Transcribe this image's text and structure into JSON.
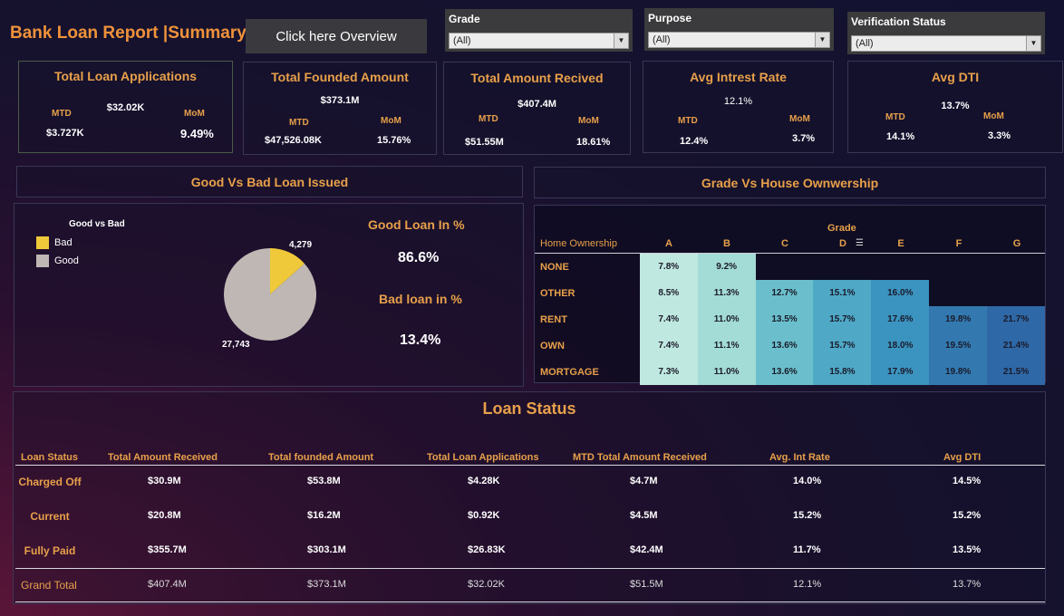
{
  "header": {
    "title": "Bank Loan Report |Summary",
    "overview_button": "Click here Overview"
  },
  "filters": [
    {
      "label": "Grade",
      "value": "(All)"
    },
    {
      "label": "Purpose",
      "value": "(All)"
    },
    {
      "label": "Verification Status",
      "value": "(All)"
    }
  ],
  "kpis": [
    {
      "title": "Total Loan Applications",
      "main": "$32.02K",
      "mtd_label": "MTD",
      "mtd": "$3.727K",
      "mom_label": "MoM",
      "mom": "9.49%"
    },
    {
      "title": "Total Founded Amount",
      "main": "$373.1M",
      "mtd_label": "MTD",
      "mtd": "$47,526.08K",
      "mom_label": "MoM",
      "mom": "15.76%"
    },
    {
      "title": "Total Amount Recived",
      "main": "$407.4M",
      "mtd_label": "MTD",
      "mtd": "$51.55M",
      "mom_label": "MoM",
      "mom": "18.61%"
    },
    {
      "title": "Avg Intrest Rate",
      "main": "12.1%",
      "mtd_label": "MTD",
      "mtd": "12.4%",
      "mom_label": "MoM",
      "mom": "3.7%"
    },
    {
      "title": "Avg DTI",
      "main": "13.7%",
      "mtd_label": "MTD",
      "mtd": "14.1%",
      "mom_label": "MoM",
      "mom": "3.3%"
    }
  ],
  "good_bad": {
    "section_title": "Good Vs Bad Loan Issued",
    "legend_title": "Good vs Bad",
    "legend": [
      {
        "label": "Bad",
        "color": "#f0c93a"
      },
      {
        "label": "Good",
        "color": "#bfb7b3"
      }
    ],
    "good_pct_label": "Good Loan In %",
    "good_pct": "86.6%",
    "bad_pct_label": "Bad loan in %",
    "bad_pct": "13.4%"
  },
  "chart_data": {
    "type": "pie",
    "title": "Good vs Bad",
    "slices": [
      {
        "label": "Bad",
        "value": 4279,
        "display": "4,279",
        "color": "#f0c93a"
      },
      {
        "label": "Good",
        "value": 27743,
        "display": "27,743",
        "color": "#bfb7b3"
      }
    ]
  },
  "heatmap": {
    "section_title": "Grade Vs House Ownwership",
    "col_header": "Grade",
    "row_header": "Home Ownership",
    "columns": [
      "A",
      "B",
      "C",
      "D",
      "E",
      "F",
      "G"
    ],
    "rows": [
      {
        "label": "NONE",
        "values": [
          "7.8%",
          "9.2%",
          "",
          "",
          "",
          "",
          ""
        ]
      },
      {
        "label": "OTHER",
        "values": [
          "8.5%",
          "11.3%",
          "12.7%",
          "15.1%",
          "16.0%",
          "",
          ""
        ]
      },
      {
        "label": "RENT",
        "values": [
          "7.4%",
          "11.0%",
          "13.5%",
          "15.7%",
          "17.6%",
          "19.8%",
          "21.7%"
        ]
      },
      {
        "label": "OWN",
        "values": [
          "7.4%",
          "11.1%",
          "13.6%",
          "15.7%",
          "18.0%",
          "19.5%",
          "21.4%"
        ]
      },
      {
        "label": "MORTGAGE",
        "values": [
          "7.3%",
          "11.0%",
          "13.6%",
          "15.8%",
          "17.9%",
          "19.8%",
          "21.5%"
        ]
      }
    ],
    "colors": [
      "#bfe8e0",
      "#a3dbd6",
      "#6bbfcc",
      "#4fa8c6",
      "#3b93bf",
      "#3379b0",
      "#2f68a6"
    ]
  },
  "loan_status": {
    "section_title": "Loan Status",
    "headers": [
      "Loan Status",
      "Total Amount Received",
      "Total founded Amount",
      "Total Loan Applications",
      "MTD Total Amount Received",
      "Avg. Int Rate",
      "Avg DTI"
    ],
    "rows": [
      {
        "label": "Charged Off",
        "values": [
          "$30.9M",
          "$53.8M",
          "$4.28K",
          "$4.7M",
          "14.0%",
          "14.5%"
        ]
      },
      {
        "label": "Current",
        "values": [
          "$20.8M",
          "$16.2M",
          "$0.92K",
          "$4.5M",
          "15.2%",
          "15.2%"
        ]
      },
      {
        "label": "Fully Paid",
        "values": [
          "$355.7M",
          "$303.1M",
          "$26.83K",
          "$42.4M",
          "11.7%",
          "13.5%"
        ]
      }
    ],
    "total": {
      "label": "Grand Total",
      "values": [
        "$407.4M",
        "$373.1M",
        "$32.02K",
        "$51.5M",
        "12.1%",
        "13.7%"
      ]
    }
  }
}
